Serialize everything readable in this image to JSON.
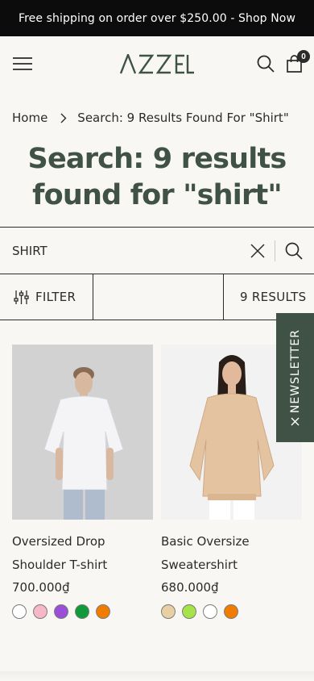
{
  "announcement": {
    "text": "Free shipping on order over $250.00 - Shop Now"
  },
  "header": {
    "logo_text": "AZZEL",
    "cart_count": "0"
  },
  "breadcrumb": {
    "home": "Home",
    "current": "Search: 9 Results Found For \"Shirt\""
  },
  "page": {
    "title": "Search: 9 results found for \"shirt\""
  },
  "search": {
    "value": "SHIRT"
  },
  "toolbar": {
    "filter_label": "FILTER",
    "results_label": "9 RESULTS"
  },
  "products": [
    {
      "title": "Oversized Drop Shoulder T-shirt",
      "price": "700.000₫",
      "swatches": [
        "#ffffff",
        "#f6b7c8",
        "#9b4fd6",
        "#109a3a",
        "#f07d00"
      ]
    },
    {
      "title": "Basic Oversize Sweatershirt",
      "price": "680.000₫",
      "swatches": [
        "#e8cfa4",
        "#a6e34a",
        "#ffffff",
        "#f07d00"
      ]
    }
  ],
  "newsletter": {
    "label": "NEWSLETTER"
  },
  "colors": {
    "accent": "#3f5245",
    "announcement_bg": "#0c0c0c",
    "page_bg": "#f8f7f3"
  }
}
